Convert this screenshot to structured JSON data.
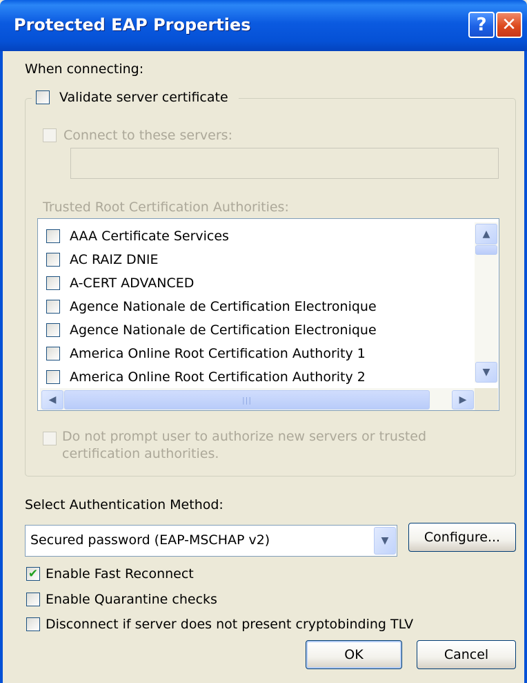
{
  "window": {
    "title": "Protected EAP Properties",
    "help_label": "?",
    "close_label": "✕"
  },
  "when_connecting_label": "When connecting:",
  "validate_cert": {
    "label": "Validate server certificate",
    "checked": false
  },
  "connect_servers": {
    "label": "Connect to these servers:",
    "checked": false,
    "enabled": false,
    "value": ""
  },
  "trusted_root_label": "Trusted Root Certification Authorities:",
  "cert_list": {
    "items": [
      {
        "label": "AAA Certificate Services",
        "checked": false
      },
      {
        "label": "AC RAIZ DNIE",
        "checked": false
      },
      {
        "label": "A-CERT ADVANCED",
        "checked": false
      },
      {
        "label": "Agence Nationale de Certification Electronique",
        "checked": false
      },
      {
        "label": "Agence Nationale de Certification Electronique",
        "checked": false
      },
      {
        "label": "America Online Root Certification Authority 1",
        "checked": false
      },
      {
        "label": "America Online Root Certification Authority 2",
        "checked": false
      }
    ],
    "scroll_up_icon": "▲",
    "scroll_down_icon": "▼",
    "scroll_left_icon": "◀",
    "scroll_right_icon": "▶",
    "thumb_grip": "|||"
  },
  "no_prompt": {
    "label_line1": "Do not prompt user to authorize new servers or trusted",
    "label_line2": "certification authorities.",
    "checked": false,
    "enabled": false
  },
  "auth_method": {
    "label": "Select Authentication Method:",
    "selected": "Secured password (EAP-MSCHAP v2)",
    "configure_label": "Configure..."
  },
  "options": {
    "fast_reconnect": {
      "label": "Enable Fast Reconnect",
      "checked": true
    },
    "quarantine": {
      "label": "Enable Quarantine checks",
      "checked": false
    },
    "cryptobinding": {
      "label": "Disconnect if server does not present cryptobinding TLV",
      "checked": false
    }
  },
  "buttons": {
    "ok": "OK",
    "cancel": "Cancel"
  },
  "colors": {
    "titlebar": "#0551D6",
    "dialog_bg": "#ECE9D8",
    "checkmark": "#21A121",
    "disabled_text": "#ACA899"
  }
}
